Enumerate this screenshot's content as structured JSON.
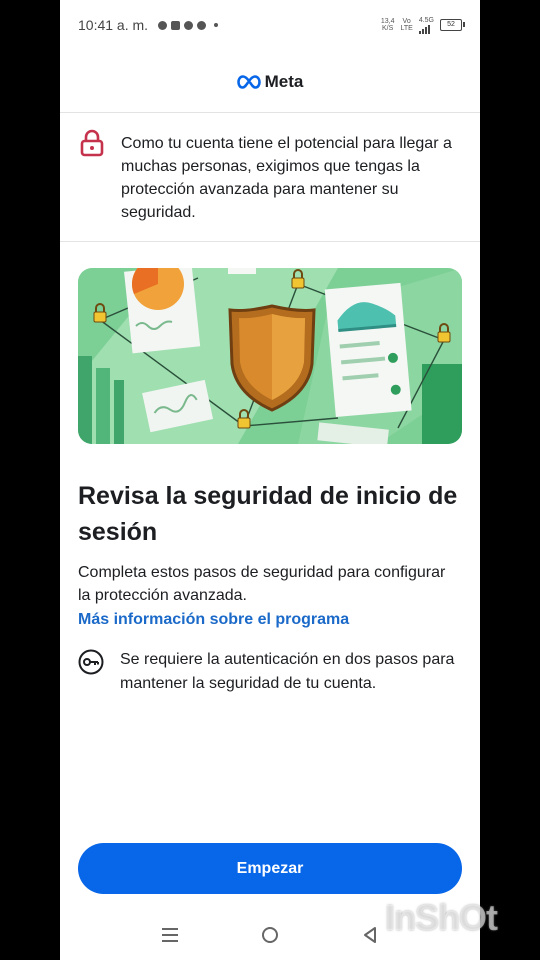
{
  "status_bar": {
    "time": "10:41 a. m.",
    "speed_value": "13,4",
    "speed_unit": "K/S",
    "network_vo": "Vo",
    "network_lte": "LTE",
    "network_type": "4.5G",
    "battery": "52"
  },
  "header": {
    "brand": "Meta",
    "brand_color": "#0866e8"
  },
  "notice": {
    "icon": "lock-icon",
    "icon_color": "#c5324b",
    "text": "Como tu cuenta tiene el potencial para llegar a muchas personas, exigimos que tengas la protección avanzada para mantener su seguridad."
  },
  "illustration": {
    "icon": "shield-illustration",
    "background": "#7ccf95"
  },
  "content": {
    "title": "Revisa la seguridad de inicio de sesión",
    "description": "Completa estos pasos de seguridad para configurar la protección avanzada.",
    "link": "Más información sobre el programa",
    "link_color": "#1b6ac9",
    "requirement_icon": "key-icon",
    "requirement": "Se requiere la autenticación en dos pasos para mantener la seguridad de tu cuenta."
  },
  "actions": {
    "start_label": "Empezar",
    "button_color": "#0866e8"
  },
  "nav": {
    "recents": "menu-icon",
    "home": "home-icon",
    "back": "back-icon"
  },
  "watermark": "InShOt"
}
